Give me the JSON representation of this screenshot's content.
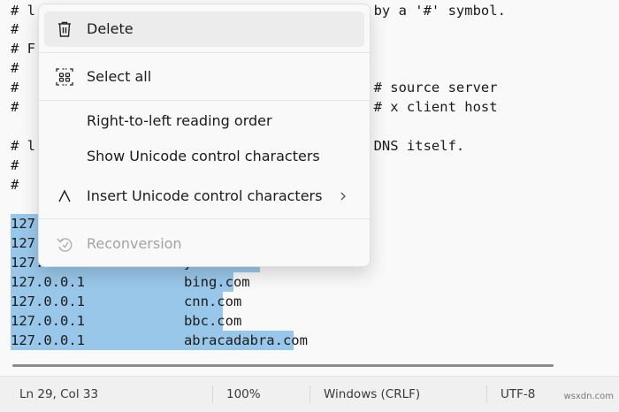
{
  "editor": {
    "lines": [
      "# l                                   noted by a '#' symbol.",
      "#",
      "# F",
      "#",
      "#                                           # source server",
      "#                                           # x client host",
      "",
      "# l                                   ithin DNS itself.",
      "#",
      "#",
      "",
      "127.",
      "127.",
      "127.0.0.1            youtube.com",
      "127.0.0.1            bing.com",
      "127.0.0.1            cnn.com",
      "127.0.0.1            bbc.com",
      "127.0.0.1            abracadabra.com"
    ]
  },
  "context_menu": {
    "delete_label": "Delete",
    "delete_icon": "trash-icon",
    "select_all_label": "Select all",
    "select_all_icon": "select-all-icon",
    "rtl_label": "Right-to-left reading order",
    "show_unicode_label": "Show Unicode control characters",
    "insert_unicode_label": "Insert Unicode control characters",
    "insert_unicode_icon": "caret-icon",
    "submenu_icon": "chevron-right-icon",
    "reconversion_label": "Reconversion",
    "reconversion_icon": "reconversion-icon"
  },
  "status_bar": {
    "position": "Ln 29, Col 33",
    "zoom": "100%",
    "line_ending": "Windows (CRLF)",
    "encoding": "UTF-8"
  },
  "watermark": "wsxdn.com",
  "colors": {
    "selection": "#99c7ea",
    "menu_background": "#f9f9f9",
    "hover": "#ececec",
    "disabled_text": "#a3a3a3"
  }
}
